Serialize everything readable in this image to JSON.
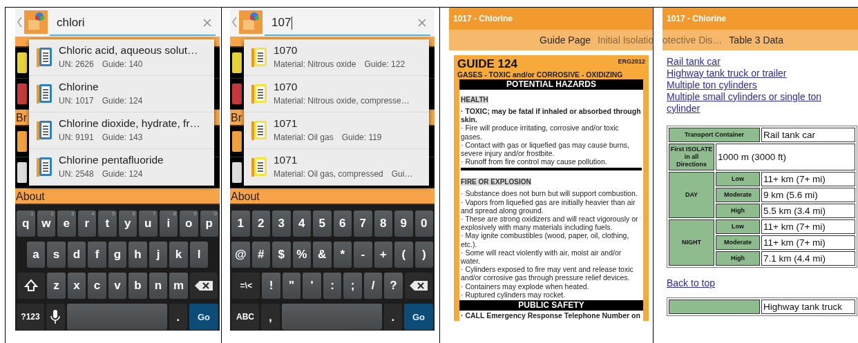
{
  "panels": [
    {
      "kind": "search",
      "query": "chlori",
      "cursor": false,
      "background_sections": [
        {
          "label": "Br"
        },
        {
          "label": "About"
        }
      ],
      "suggestions": [
        {
          "kind": "name",
          "title": "Chloric acid, aqueous solut…",
          "details": [
            "UN: 2626",
            "Guide: 140"
          ]
        },
        {
          "kind": "name",
          "title": "Chlorine",
          "details": [
            "UN: 1017",
            "Guide: 124"
          ]
        },
        {
          "kind": "name",
          "title": "Chlorine dioxide, hydrate, fr…",
          "details": [
            "UN: 9191",
            "Guide: 143"
          ]
        },
        {
          "kind": "name",
          "title": "Chlorine pentafluoride",
          "details": [
            "UN: 2548",
            "Guide: 124"
          ]
        }
      ],
      "keyboard": [
        [
          {
            "kind": "char",
            "label": "q",
            "hint": "1"
          },
          {
            "kind": "char",
            "label": "w",
            "hint": "2"
          },
          {
            "kind": "char",
            "label": "e",
            "hint": "3"
          },
          {
            "kind": "char",
            "label": "r",
            "hint": "4"
          },
          {
            "kind": "char",
            "label": "t",
            "hint": "5"
          },
          {
            "kind": "char",
            "label": "y",
            "hint": "6"
          },
          {
            "kind": "char",
            "label": "u",
            "hint": "7"
          },
          {
            "kind": "char",
            "label": "i",
            "hint": "8"
          },
          {
            "kind": "char",
            "label": "o",
            "hint": "9"
          },
          {
            "kind": "char",
            "label": "p",
            "hint": "0"
          }
        ],
        [
          {
            "kind": "char",
            "label": "a"
          },
          {
            "kind": "char",
            "label": "s"
          },
          {
            "kind": "char",
            "label": "d"
          },
          {
            "kind": "char",
            "label": "f"
          },
          {
            "kind": "char",
            "label": "g"
          },
          {
            "kind": "char",
            "label": "h"
          },
          {
            "kind": "char",
            "label": "j"
          },
          {
            "kind": "char",
            "label": "k"
          },
          {
            "kind": "char",
            "label": "l"
          }
        ],
        [
          {
            "kind": "shift"
          },
          {
            "kind": "char",
            "label": "z"
          },
          {
            "kind": "char",
            "label": "x"
          },
          {
            "kind": "char",
            "label": "c"
          },
          {
            "kind": "char",
            "label": "v"
          },
          {
            "kind": "char",
            "label": "b"
          },
          {
            "kind": "char",
            "label": "n"
          },
          {
            "kind": "char",
            "label": "m"
          },
          {
            "kind": "backspace"
          }
        ],
        [
          {
            "kind": "mode",
            "label": "?123"
          },
          {
            "kind": "mic"
          },
          {
            "kind": "space"
          },
          {
            "kind": "dot",
            "label": "."
          },
          {
            "kind": "action",
            "label": "Go"
          }
        ]
      ]
    },
    {
      "kind": "search",
      "query": "107",
      "cursor": true,
      "background_sections": [
        {
          "label": "Br"
        },
        {
          "label": "About"
        }
      ],
      "suggestions": [
        {
          "kind": "number",
          "title": "1070",
          "details": [
            "Material: Nitrous oxide",
            "Guide: 122"
          ]
        },
        {
          "kind": "number",
          "title": "1070",
          "details": [
            "Material: Nitrous oxide, compresse…"
          ]
        },
        {
          "kind": "number",
          "title": "1071",
          "details": [
            "Material: Oil gas",
            "Guide: 119"
          ]
        },
        {
          "kind": "number",
          "title": "1071",
          "details": [
            "Material: Oil gas, compressed",
            "Gui…"
          ]
        }
      ],
      "keyboard": [
        [
          {
            "kind": "char",
            "label": "1"
          },
          {
            "kind": "char",
            "label": "2"
          },
          {
            "kind": "char",
            "label": "3"
          },
          {
            "kind": "char",
            "label": "4"
          },
          {
            "kind": "char",
            "label": "5"
          },
          {
            "kind": "char",
            "label": "6"
          },
          {
            "kind": "char",
            "label": "7"
          },
          {
            "kind": "char",
            "label": "8"
          },
          {
            "kind": "char",
            "label": "9"
          },
          {
            "kind": "char",
            "label": "0"
          }
        ],
        [
          {
            "kind": "char",
            "label": "@"
          },
          {
            "kind": "char",
            "label": "#"
          },
          {
            "kind": "char",
            "label": "$"
          },
          {
            "kind": "char",
            "label": "%"
          },
          {
            "kind": "char",
            "label": "&"
          },
          {
            "kind": "char",
            "label": "*"
          },
          {
            "kind": "char",
            "label": "-"
          },
          {
            "kind": "char",
            "label": "+"
          },
          {
            "kind": "char",
            "label": "("
          },
          {
            "kind": "char",
            "label": ")"
          }
        ],
        [
          {
            "kind": "mode",
            "label": "=\\<"
          },
          {
            "kind": "char",
            "label": "!"
          },
          {
            "kind": "char",
            "label": "\""
          },
          {
            "kind": "char",
            "label": "'"
          },
          {
            "kind": "char",
            "label": ":"
          },
          {
            "kind": "char",
            "label": ";"
          },
          {
            "kind": "char",
            "label": "/"
          },
          {
            "kind": "char",
            "label": "?"
          },
          {
            "kind": "backspace"
          }
        ],
        [
          {
            "kind": "mode",
            "label": "ABC"
          },
          {
            "kind": "dot",
            "label": ","
          },
          {
            "kind": "space"
          },
          {
            "kind": "dot",
            "label": "."
          },
          {
            "kind": "action",
            "label": "Go"
          }
        ]
      ]
    },
    {
      "kind": "guide",
      "title": "1017 - Chlorine",
      "tabs": [
        {
          "label": "Guide Page",
          "selected": true
        },
        {
          "label": "Initial Isolatio",
          "selected": false
        }
      ],
      "guide": {
        "heading": "GUIDE 124",
        "edition": "ERG2012",
        "subtitle": "GASES - TOXIC and/or CORROSIVE - OXIDIZING",
        "sections": [
          {
            "title": "POTENTIAL HAZARDS",
            "groups": [
              {
                "title": "HEALTH",
                "items": [
                  {
                    "text": "· TOXIC; may be fatal if inhaled or absorbed through skin.",
                    "bold": true
                  },
                  {
                    "text": "· Fire will produce irritating, corrosive and/or toxic gases.",
                    "bold": false
                  },
                  {
                    "text": "· Contact with gas or liquefied gas may cause burns, severe injury and/or frostbite.",
                    "bold": false
                  },
                  {
                    "text": "· Runoff from fire control may cause pollution.",
                    "bold": false
                  }
                ]
              },
              {
                "title": "FIRE OR EXPLOSION",
                "items": [
                  {
                    "text": "· Substance does not burn but will support combustion.",
                    "bold": false
                  },
                  {
                    "text": "· Vapors from liquefied gas are initially heavier than air and spread along ground.",
                    "bold": false
                  },
                  {
                    "text": "· These are strong oxidizers and will react vigorously or explosively with many materials including fuels.",
                    "bold": false
                  },
                  {
                    "text": "· May ignite combustibles (wood, paper, oil, clothing, etc.).",
                    "bold": false
                  },
                  {
                    "text": "· Some will react violently with air, moist air and/or water.",
                    "bold": false
                  },
                  {
                    "text": "· Cylinders exposed to fire may vent and release toxic and/or corrosive gas through pressure relief devices.",
                    "bold": false
                  },
                  {
                    "text": "· Containers may explode when heated.",
                    "bold": false
                  },
                  {
                    "text": "· Ruptured cylinders may rocket.",
                    "bold": false
                  }
                ]
              }
            ]
          },
          {
            "title": "PUBLIC SAFETY",
            "groups": [
              {
                "items": [
                  {
                    "text": "· CALL Emergency Response Telephone Number on",
                    "bold": true
                  }
                ]
              }
            ]
          }
        ]
      }
    },
    {
      "kind": "table",
      "title": "1017 - Chlorine",
      "tabs": [
        {
          "label": "otective Dis…",
          "selected": false
        },
        {
          "label": "Table 3 Data",
          "selected": true
        }
      ],
      "links": [
        "Rail tank car",
        "Highway tank truck or trailer",
        "Multiple ton cylinders",
        "Multiple small cylinders or single ton cylinder"
      ],
      "table": {
        "container_label": "Transport Container",
        "container": "Rail tank car",
        "isolate_label": "First ISOLATE in all Directions",
        "isolate": "1000 m (3000 ft)",
        "periods": [
          {
            "label": "DAY",
            "rows": [
              {
                "label": "Low",
                "distance": "11+ km (7+ mi)"
              },
              {
                "label": "Moderate",
                "distance": "9 km (5.6 mi)"
              },
              {
                "label": "High",
                "distance": "5.5 km (3.4 mi)"
              }
            ]
          },
          {
            "label": "NIGHT",
            "rows": [
              {
                "label": "Low",
                "distance": "11+ km (7+ mi)"
              },
              {
                "label": "Moderate",
                "distance": "11+ km (7+ mi)"
              },
              {
                "label": "High",
                "distance": "7.1 km (4.4 mi)"
              }
            ]
          }
        ]
      },
      "back_link": "Back to top",
      "next_container": "Highway tank truck"
    }
  ]
}
